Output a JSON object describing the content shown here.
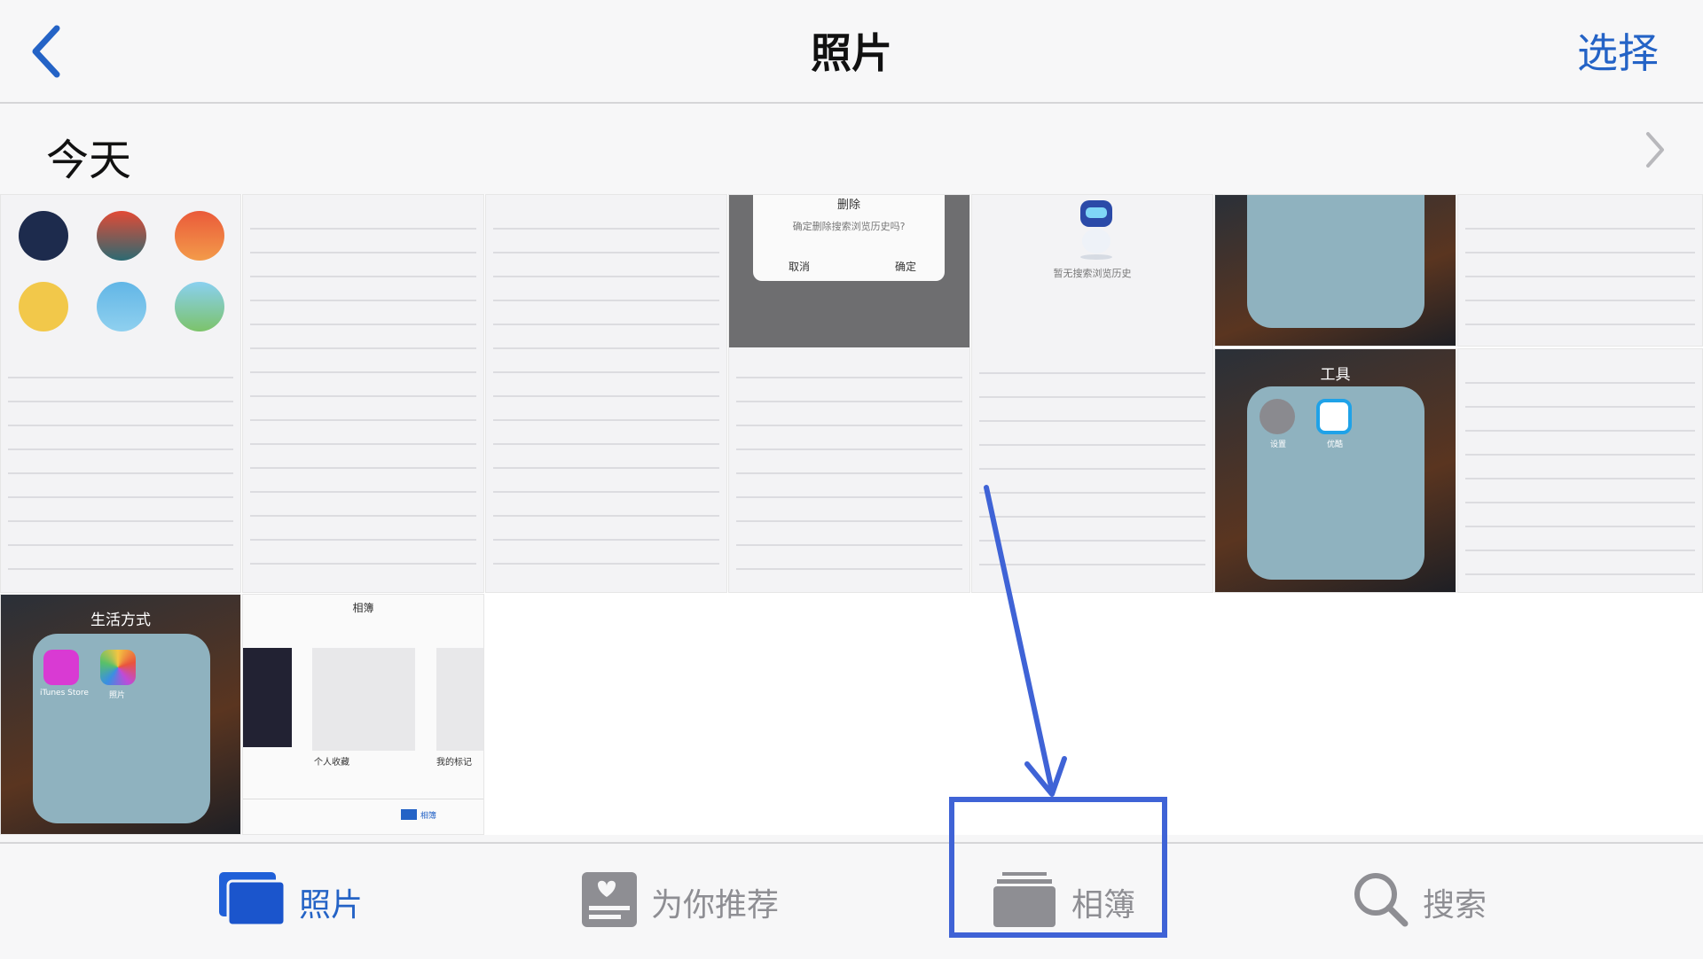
{
  "nav": {
    "title": "照片",
    "select_label": "选择",
    "back_icon": "chevron-left-icon"
  },
  "section": {
    "label": "今天",
    "chevron_icon": "chevron-right-icon"
  },
  "thumbnails": {
    "t5_dialog_title": "删除",
    "t5_dialog_message": "确定删除搜索浏览历史吗?",
    "t5_cancel": "取消",
    "t5_confirm": "确定",
    "t6_caption": "暂无搜索浏览历史",
    "t7_folder_title": "工具",
    "t8_folder_title": "生活方式",
    "t9_album_title": "相簿",
    "t9_album1": "个人收藏",
    "t9_album2": "我的标记",
    "t9_tab_label": "相簿",
    "t7_app1": "设置",
    "t7_app2": "优酷",
    "t8_app1": "iTunes Store",
    "t8_app2": "照片"
  },
  "tabs": [
    {
      "label": "照片",
      "icon": "photos-icon",
      "active": true
    },
    {
      "label": "为你推荐",
      "icon": "for-you-icon",
      "active": false
    },
    {
      "label": "相簿",
      "icon": "albums-icon",
      "active": false
    },
    {
      "label": "搜索",
      "icon": "search-icon",
      "active": false
    }
  ],
  "colors": {
    "accent": "#2463c6",
    "inactive": "#8e8e93",
    "annotation": "#3f63d6"
  }
}
